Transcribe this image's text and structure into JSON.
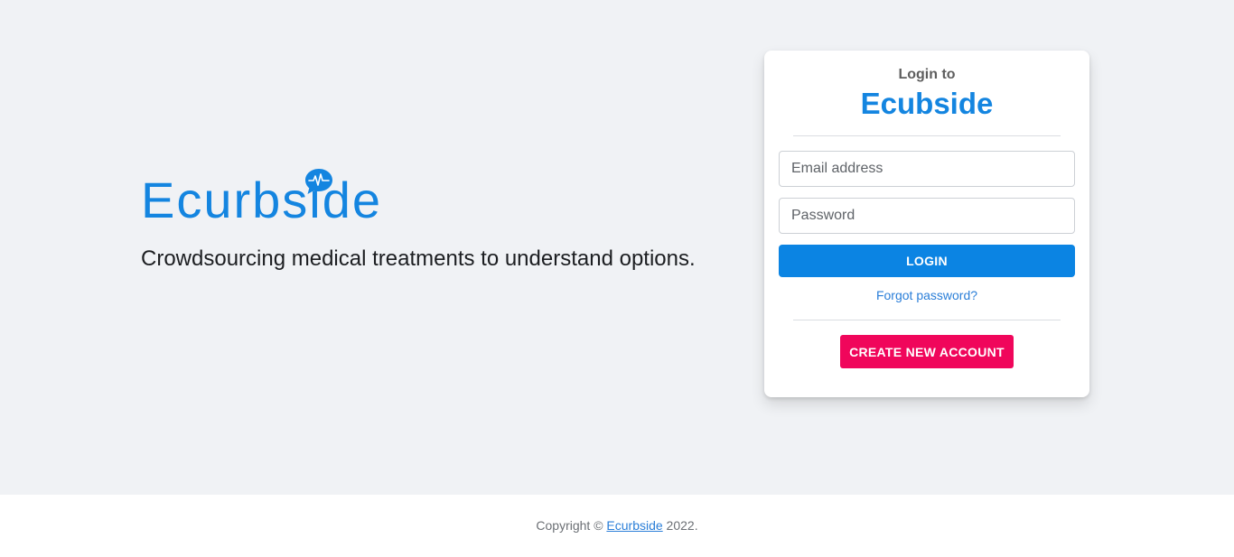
{
  "brand": {
    "logo_text": "Ecurbside",
    "logo_icon": "speech-bubble-heartbeat-icon",
    "tagline": "Crowdsourcing medical treatments to understand options."
  },
  "login_card": {
    "subtitle": "Login to",
    "title": "Ecubside",
    "email_placeholder": "Email address",
    "password_placeholder": "Password",
    "login_label": "LOGIN",
    "forgot_label": "Forgot password?",
    "create_label": "CREATE NEW ACCOUNT"
  },
  "footer": {
    "prefix": "Copyright © ",
    "link_text": "Ecurbside",
    "suffix": " 2022."
  },
  "colors": {
    "brand_blue": "#1485e0",
    "login_button": "#0b84e3",
    "create_button": "#f0065b",
    "background": "#f0f2f5"
  }
}
